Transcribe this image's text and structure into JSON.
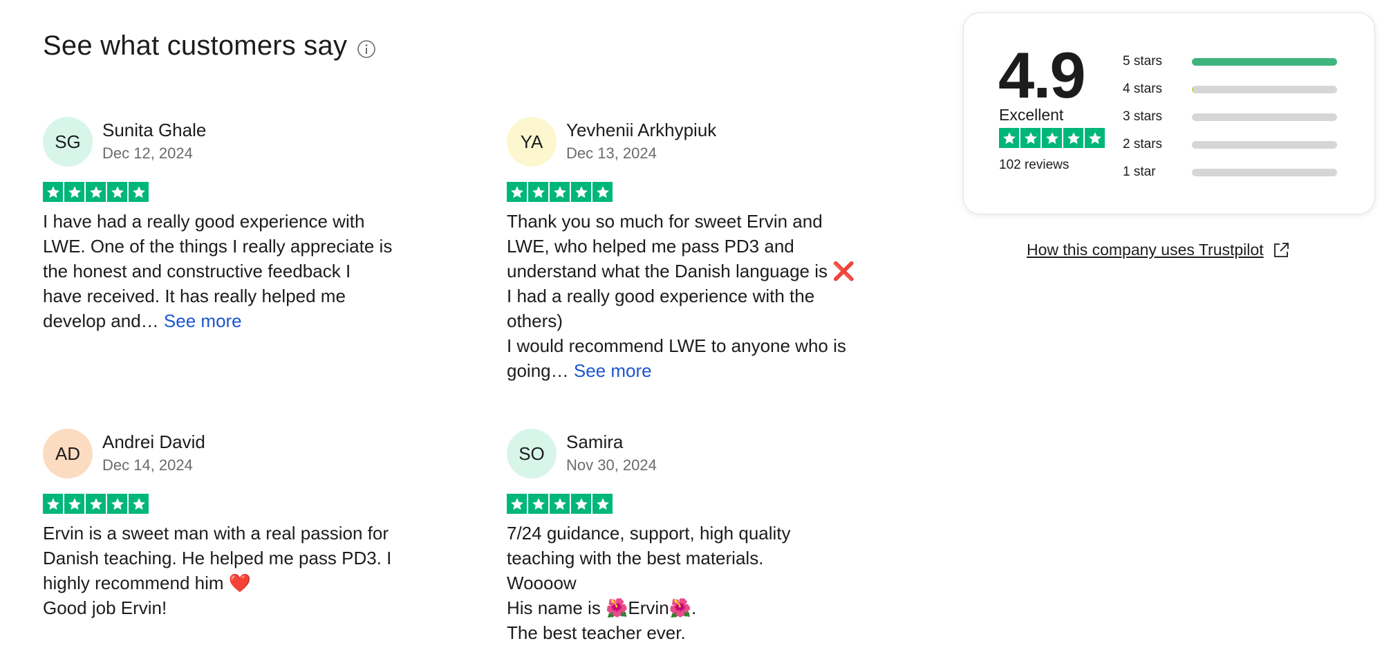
{
  "heading": {
    "title": "See what customers say",
    "info_icon": "info-icon"
  },
  "colors": {
    "trustpilot_green": "#00b67a",
    "link_blue": "#1a55d1",
    "bar_fill": "#3fb47c",
    "bar_track": "#d6d6d6"
  },
  "reviews": [
    {
      "initials": "SG",
      "avatar_color": "#d8f5ea",
      "name": "Sunita Ghale",
      "date": "Dec 12, 2024",
      "rating": 5,
      "lines": [
        "I have had a really good experience with",
        "LWE. One of the things I really appreciate is",
        "the honest and constructive feedback I",
        "have received. It has really helped me",
        "develop and…"
      ],
      "see_more": "See more"
    },
    {
      "initials": "YA",
      "avatar_color": "#fdf7cf",
      "name": "Yevhenii Arkhypiuk",
      "date": "Dec 13, 2024",
      "rating": 5,
      "lines": [
        "Thank you so much for sweet Ervin and",
        "LWE, who helped me pass PD3 and",
        "understand what the Danish language is ❌",
        "I had a really good experience with the",
        "others)",
        "I would recommend LWE to anyone who is",
        "going…"
      ],
      "see_more": "See more"
    },
    {
      "initials": "AD",
      "avatar_color": "#fcdcc1",
      "name": "Andrei David",
      "date": "Dec 14, 2024",
      "rating": 5,
      "lines": [
        "Ervin is a sweet man with a real passion for",
        "Danish teaching. He helped me pass PD3. I",
        "highly recommend him ❤️",
        "Good job Ervin!"
      ],
      "see_more": ""
    },
    {
      "initials": "SO",
      "avatar_color": "#d8f5ea",
      "name": "Samira",
      "date": "Nov 30, 2024",
      "rating": 5,
      "lines": [
        "7/24 guidance, support, high quality",
        "teaching with the best materials.",
        "Woooow",
        "His name is 🌺Ervin🌺.",
        "The best teacher ever."
      ],
      "see_more": ""
    }
  ],
  "summary": {
    "score": "4.9",
    "label": "Excellent",
    "review_count": "102 reviews",
    "distribution": [
      {
        "label": "5 stars",
        "fraction": 1.0
      },
      {
        "label": "4 stars",
        "fraction": 0.01
      },
      {
        "label": "3 stars",
        "fraction": 0.0
      },
      {
        "label": "2 stars",
        "fraction": 0.0
      },
      {
        "label": "1 star",
        "fraction": 0.0
      }
    ]
  },
  "trustpilot_link": {
    "text": "How this company uses Trustpilot",
    "icon": "external-link-icon"
  }
}
